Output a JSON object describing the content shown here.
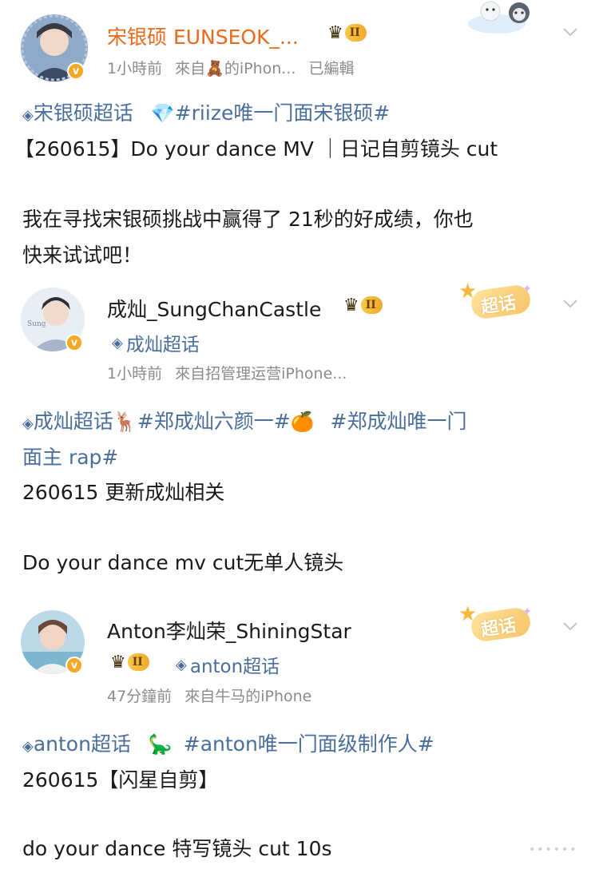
{
  "posts": [
    {
      "user": {
        "name": "宋银硕 EUNSEOK_...",
        "crown_level": "II"
      },
      "meta": {
        "time": "1小時前",
        "from_prefix": "來自",
        "from_emoji": "🧸",
        "from_suffix": "的iPhon...",
        "edited": "已編輯"
      },
      "lines": {
        "l1_topic": "宋银硕超话",
        "l1_emoji": "💎",
        "l1_hashtag": "#riize唯一门面宋银硕#",
        "l2": "【260615】Do your dance MV ｜日记自剪镜头 cut",
        "l3": "我在寻找宋银硕挑战中赢得了 21秒的好成绩，你也",
        "l4": "快来试试吧！"
      }
    },
    {
      "user": {
        "name": "成灿_SungChanCastle",
        "crown_level": "II",
        "topic": "成灿超话"
      },
      "meta": {
        "time": "1小時前",
        "from": "來自招管理运营iPhone..."
      },
      "badge": "超话",
      "lines": {
        "l1_topic": "成灿超话",
        "l1_emoji1": "🦌",
        "l1_hashtag1": "#郑成灿六颜一#",
        "l1_emoji2": "🍊",
        "l1_hashtag2": "#郑成灿唯一门",
        "l2": "面主 rap#",
        "l3": "260615 更新成灿相关",
        "l4": "Do your dance mv cut无单人镜头"
      }
    },
    {
      "user": {
        "name": "Anton李灿荣_ShiningStar",
        "crown_level": "II",
        "topic": "anton超话"
      },
      "meta": {
        "time": "47分鐘前",
        "from": "來自牛马的iPhone"
      },
      "badge": "超话",
      "lines": {
        "l1_topic": "anton超话",
        "l1_emoji": "🦕",
        "l1_hashtag": "#anton唯一门面级制作人#",
        "l2": "260615【闪星自剪】",
        "l3": "do your dance 特写镜头 cut 10s"
      }
    }
  ],
  "icons": {
    "verified": "v-badge-icon",
    "diamond": "diamond-icon",
    "chevron": "chevron-down-icon",
    "crown": "crown-icon"
  },
  "colors": {
    "name_vip": "#e86a1c",
    "link": "#4a6e9c",
    "meta": "#8b8b8b"
  }
}
